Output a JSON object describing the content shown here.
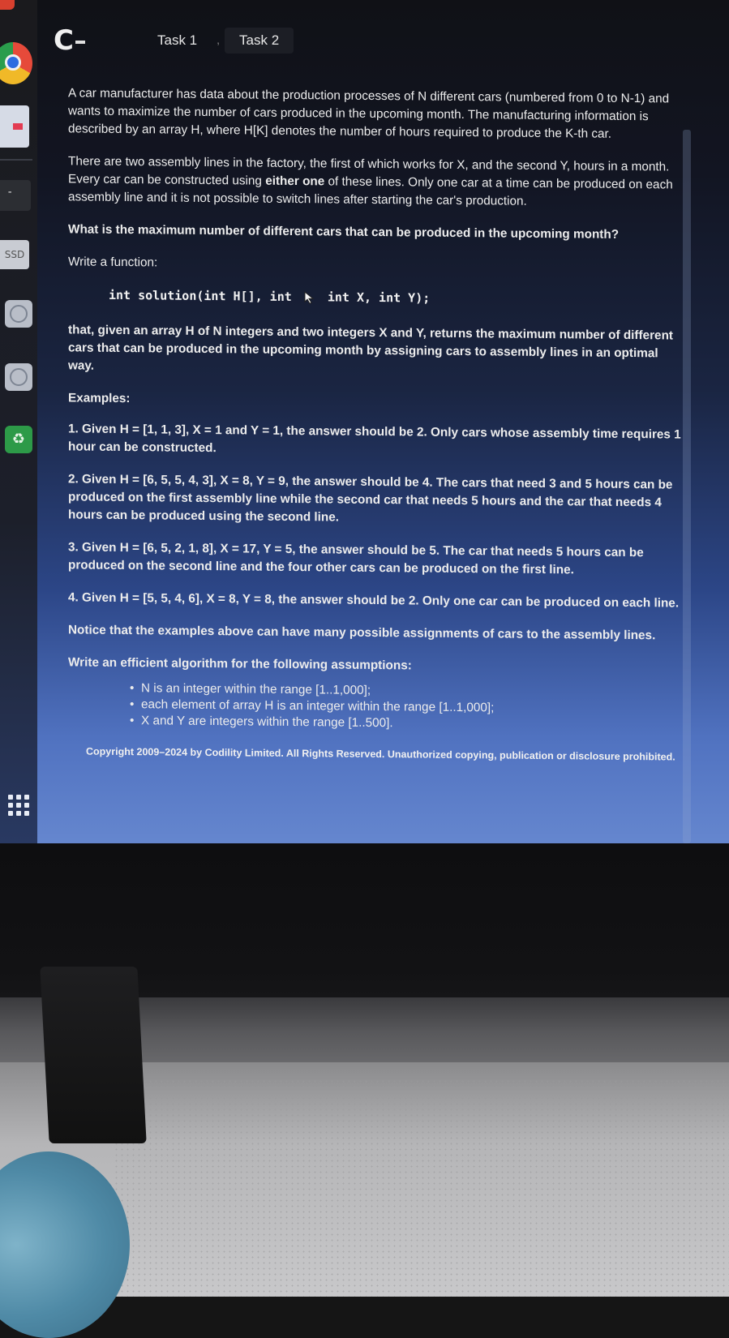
{
  "header": {
    "logo_text": "C",
    "tabs": [
      {
        "label": "Task 1",
        "active": false
      },
      {
        "label": "Task 2",
        "active": true
      }
    ]
  },
  "dock": {
    "ssd_label": "SSD",
    "term_label": "-"
  },
  "problem": {
    "p1": "A car manufacturer has data about the production processes of N different cars (numbered from 0 to N-1) and wants to maximize the number of cars produced in the upcoming month. The manufacturing information is described by an array H, where H[K] denotes the number of hours required to produce the K-th car.",
    "p2_a": "There are two assembly lines in the factory, the first of which works for X, and the second Y, hours in a month. Every car can be constructed using ",
    "p2_b": "either one",
    "p2_c": " of these lines. Only one car at a time can be produced on each assembly line and it is not possible to switch lines after starting the car's production.",
    "p3_a": "What is the maximum number of ",
    "p3_b": "different",
    "p3_c": " cars that can be produced in the upcoming month?",
    "p4": "Write a function:",
    "code_a": "int solution(int H[], int",
    "code_b": "int X, int Y);",
    "p5": "that, given an array H of N integers and two integers X and Y, returns the maximum number of different cars that can be produced in the upcoming month by assigning cars to assembly lines in an optimal way.",
    "examples_heading": "Examples:",
    "ex1": "1. Given H = [1, 1, 3], X = 1 and Y = 1, the answer should be 2. Only cars whose assembly time requires 1 hour can be constructed.",
    "ex2": "2. Given H = [6, 5, 5, 4, 3], X = 8, Y = 9, the answer should be 4. The cars that need 3 and 5 hours can be produced on the first assembly line while the second car that needs 5 hours and the car that needs 4 hours can be produced using the second line.",
    "ex3": "3. Given H = [6, 5, 2, 1, 8], X = 17, Y = 5, the answer should be 5. The car that needs 5 hours can be produced on the second line and the four other cars can be produced on the first line.",
    "ex4": "4. Given H = [5, 5, 4, 6], X = 8, Y = 8, the answer should be 2. Only one car can be produced on each line.",
    "notice": "Notice that the examples above can have many possible assignments of cars to the assembly lines.",
    "efficient_a": "Write an ",
    "efficient_b": "efficient",
    "efficient_c": " algorithm for the following assumptions:",
    "assumptions": [
      "N is an integer within the range [1..1,000];",
      "each element of array H is an integer within the range [1..1,000];",
      "X and Y are integers within the range [1..500]."
    ],
    "copyright": "Copyright 2009–2024 by Codility Limited. All Rights Reserved. Unauthorized copying, publication or disclosure prohibited."
  }
}
